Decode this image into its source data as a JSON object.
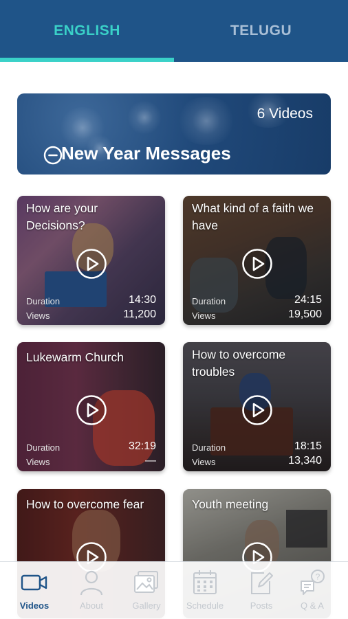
{
  "tabs": [
    {
      "label": "ENGLISH",
      "active": true
    },
    {
      "label": "TELUGU",
      "active": false
    }
  ],
  "banner": {
    "count": "6 Videos",
    "title": "New Year Messages",
    "icon": "collapse-circle-icon"
  },
  "videos": [
    {
      "title": "How are your Decisions?",
      "duration_label": "Duration",
      "duration": "14:30",
      "views_label": "Views",
      "views": "11,200"
    },
    {
      "title": "What kind of a faith we have",
      "duration_label": "Duration",
      "duration": "24:15",
      "views_label": "Views",
      "views": "19,500"
    },
    {
      "title": "Lukewarm Church",
      "duration_label": "Duration",
      "duration": "32:19",
      "views_label": "Views",
      "views": "—"
    },
    {
      "title": "How to overcome troubles",
      "duration_label": "Duration",
      "duration": "18:15",
      "views_label": "Views",
      "views": "13,340"
    },
    {
      "title": "How to overcome fear"
    },
    {
      "title": "Youth meeting"
    }
  ],
  "bottom_nav": [
    {
      "label": "Videos",
      "icon": "video-camera-icon",
      "active": true
    },
    {
      "label": "About",
      "icon": "person-icon",
      "active": false
    },
    {
      "label": "Gallery",
      "icon": "gallery-icon",
      "active": false
    },
    {
      "label": "Schedule",
      "icon": "calendar-icon",
      "active": false
    },
    {
      "label": "Posts",
      "icon": "edit-post-icon",
      "active": false
    },
    {
      "label": "Q & A",
      "icon": "question-chat-icon",
      "active": false
    }
  ],
  "colors": {
    "header": "#1f5488",
    "accent": "#3ad1c8",
    "inactive_tab": "#a9bfd6",
    "nav_inactive": "#c4c9cf"
  }
}
